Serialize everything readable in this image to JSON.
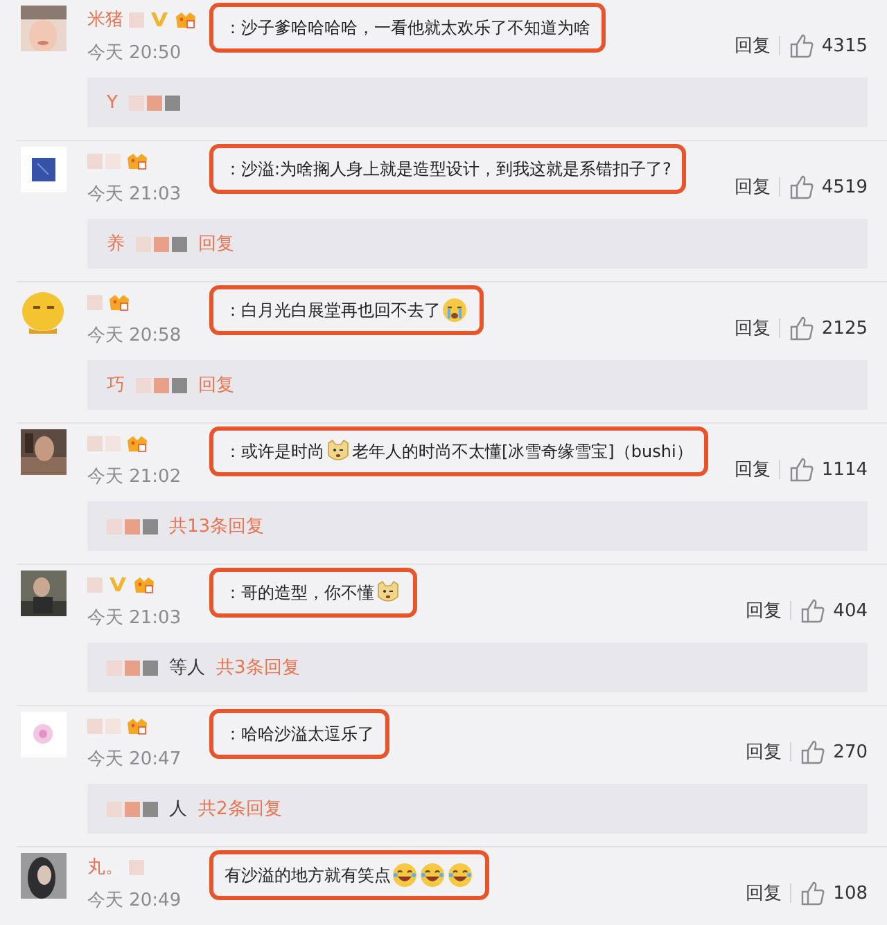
{
  "comments": [
    {
      "name": "米猪",
      "verified": true,
      "vip": true,
      "segments": [
        {
          "kind": "text",
          "text": "：沙子爹哈哈哈哈，一看他就太欢乐了不知道为啥"
        }
      ],
      "time": "今天 20:50",
      "reply": "回复",
      "likes": "4315",
      "thread": {
        "author": "Y"
      }
    },
    {
      "verified": false,
      "vip": true,
      "segments": [
        {
          "kind": "text",
          "text": "：沙溢:为啥搁人身上就是造型设计，到我这就是系错扣子了?"
        }
      ],
      "time": "今天 21:03",
      "reply": "回复",
      "likes": "4519",
      "thread": {
        "author": "养",
        "link": "回复"
      }
    },
    {
      "verified": false,
      "vip": true,
      "segments": [
        {
          "kind": "text",
          "text": "：白月光白展堂再也回不去了"
        },
        {
          "kind": "crying"
        }
      ],
      "time": "今天 20:58",
      "reply": "回复",
      "likes": "2125",
      "thread": {
        "author": "巧",
        "link": "回复"
      }
    },
    {
      "verified": false,
      "vip": true,
      "segments": [
        {
          "kind": "text",
          "text": "：或许是时尚"
        },
        {
          "kind": "doge"
        },
        {
          "kind": "text",
          "text": " 老年人的时尚不太懂[冰雪奇缘雪宝]（bushi）"
        }
      ],
      "time": "今天 21:02",
      "reply": "回复",
      "likes": "1114",
      "thread": {
        "link": "共13条回复"
      }
    },
    {
      "verified": true,
      "vip": true,
      "segments": [
        {
          "kind": "text",
          "text": "：哥的造型，你不懂"
        },
        {
          "kind": "doge"
        }
      ],
      "time": "今天 21:03",
      "reply": "回复",
      "likes": "404",
      "thread": {
        "note": "等人",
        "link": "共3条回复"
      }
    },
    {
      "verified": false,
      "vip": true,
      "segments": [
        {
          "kind": "text",
          "text": "：哈哈沙溢太逗乐了"
        }
      ],
      "time": "今天 20:47",
      "reply": "回复",
      "likes": "270",
      "thread": {
        "note": "人",
        "link": "共2条回复"
      }
    },
    {
      "name": "丸。",
      "verified": false,
      "vip": false,
      "segments": [
        {
          "kind": "text",
          "text": "有沙溢的地方就有笑点"
        },
        {
          "kind": "laughing"
        },
        {
          "kind": "laughing"
        },
        {
          "kind": "laughing"
        }
      ],
      "time": "今天 20:49",
      "reply": "回复",
      "likes": "108"
    }
  ]
}
